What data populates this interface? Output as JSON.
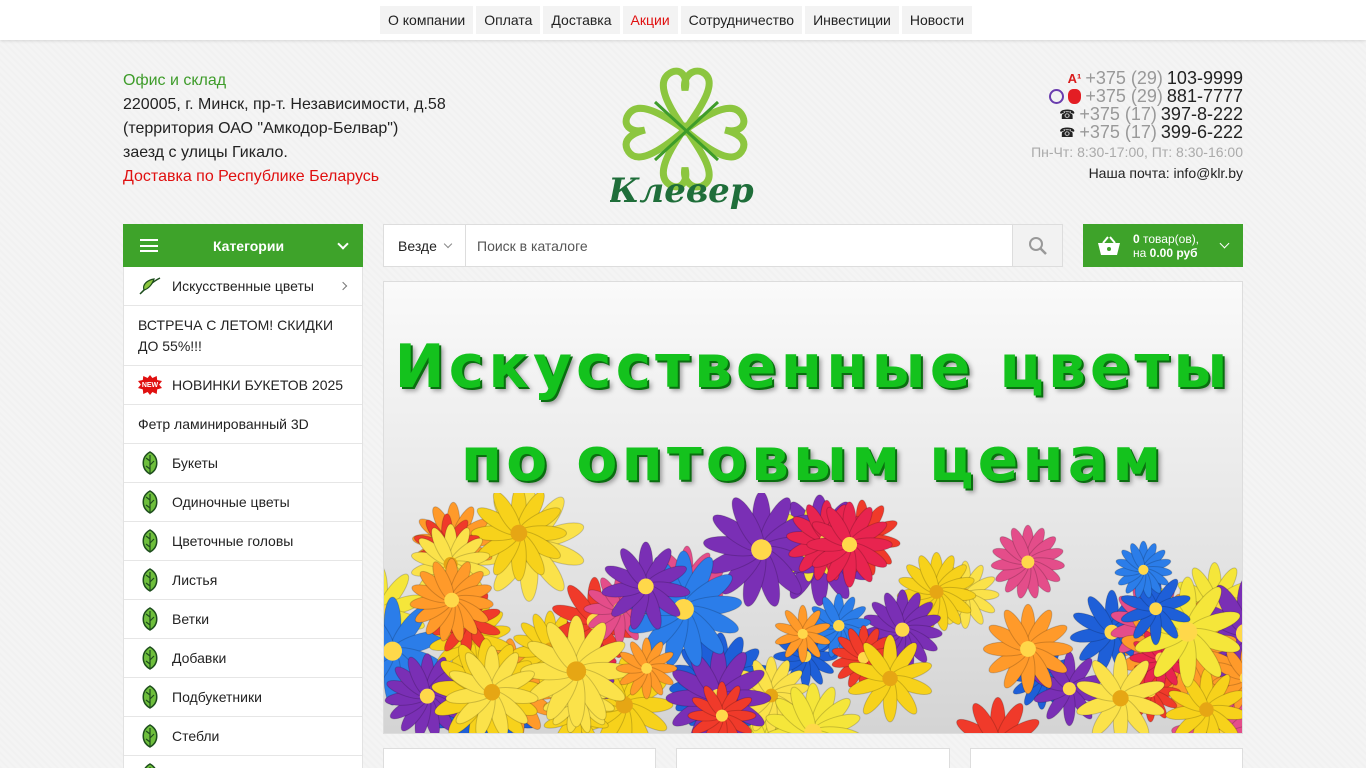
{
  "topnav": [
    {
      "label": "О компании"
    },
    {
      "label": "Оплата"
    },
    {
      "label": "Доставка"
    },
    {
      "label": "Акции",
      "accent": true
    },
    {
      "label": "Сотрудничество"
    },
    {
      "label": "Инвестиции"
    },
    {
      "label": "Новости"
    }
  ],
  "address": {
    "title": "Офис и склад",
    "line1": "220005, г. Минск, пр-т. Независимости, д.58",
    "line2": "(территория ОАО \"Амкодор-Белвар\")",
    "line3": "заезд с улицы Гикало.",
    "delivery": "Доставка по Республике Беларусь"
  },
  "logo": {
    "text": "Клевер"
  },
  "contacts": {
    "phones": [
      {
        "code": "+375 (29)",
        "number": "103-9999",
        "icons": [
          "a1-icon"
        ]
      },
      {
        "code": "+375 (29)",
        "number": "881-7777",
        "icons": [
          "viber-icon",
          "mts-icon"
        ]
      },
      {
        "code": "+375 (17)",
        "number": "397-8-222",
        "icons": [
          "phone-icon"
        ]
      },
      {
        "code": "+375 (17)",
        "number": "399-6-222",
        "icons": [
          "phone-icon"
        ]
      }
    ],
    "hours": "Пн-Чт: 8:30-17:00, Пт: 8:30-16:00",
    "email": "Наша почта: info@klr.by"
  },
  "categories": {
    "title": "Категории",
    "items": [
      {
        "label": "Искусственные цветы",
        "icon": "leaf-icon",
        "arrow": true
      },
      {
        "label": "ВСТРЕЧА С ЛЕТОМ! СКИДКИ ДО 55%!!!",
        "icon": "",
        "tall": true
      },
      {
        "label": "НОВИНКИ БУКЕТОВ 2025",
        "icon": "new-badge-icon",
        "badge": "NEW"
      },
      {
        "label": "Фетр ламинированный 3D",
        "icon": ""
      },
      {
        "label": "Букеты",
        "icon": "leaf-icon"
      },
      {
        "label": "Одиночные цветы",
        "icon": "leaf-icon"
      },
      {
        "label": "Цветочные головы",
        "icon": "leaf-icon"
      },
      {
        "label": "Листья",
        "icon": "leaf-icon"
      },
      {
        "label": "Ветки",
        "icon": "leaf-icon"
      },
      {
        "label": "Добавки",
        "icon": "leaf-icon"
      },
      {
        "label": "Подбукетники",
        "icon": "leaf-icon"
      },
      {
        "label": "Стебли",
        "icon": "leaf-icon"
      },
      {
        "label": "",
        "icon": "leaf-icon"
      }
    ]
  },
  "search": {
    "scope": "Везде",
    "placeholder": "Поиск в каталоге"
  },
  "cart": {
    "count": "0",
    "count_suffix": " товар(ов),",
    "prefix": "на ",
    "total": "0.00 руб"
  },
  "banner": {
    "line1": "Искусственные цветы",
    "line2": "по оптовым ценам"
  },
  "colors": {
    "accent": "#3ea32a",
    "alert": "#e01010"
  }
}
